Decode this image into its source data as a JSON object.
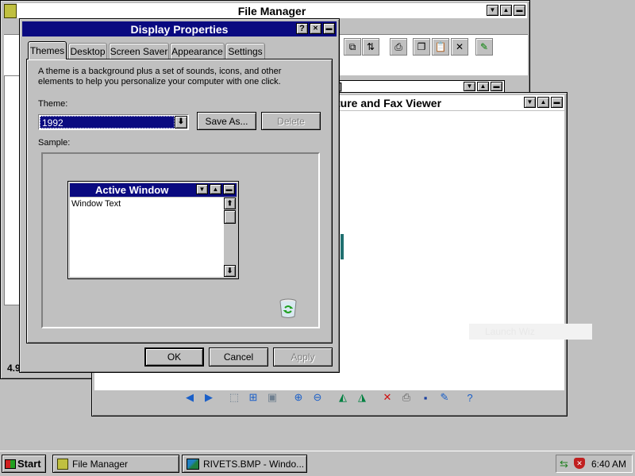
{
  "file_manager": {
    "title": "File Manager",
    "status_value": "4.9",
    "inner_title_partial": "]"
  },
  "picture_viewer": {
    "title_partial": "ture and Fax Viewer",
    "image_label": "Launch Wiz"
  },
  "display_properties": {
    "title": "Display Properties",
    "tabs": [
      {
        "label": "Themes",
        "selected": true
      },
      {
        "label": "Desktop",
        "selected": false
      },
      {
        "label": "Screen Saver",
        "selected": false
      },
      {
        "label": "Appearance",
        "selected": false
      },
      {
        "label": "Settings",
        "selected": false
      }
    ],
    "description": "A theme is a background plus a set of sounds, icons, and other elements to help you personalize your computer with one click.",
    "theme_label": "Theme:",
    "theme_value": "1992",
    "save_as_label": "Save As...",
    "delete_label": "Delete",
    "sample_label": "Sample:",
    "sample_window": {
      "title": "Active Window",
      "text": "Window Text"
    },
    "ok_label": "OK",
    "cancel_label": "Cancel",
    "apply_label": "Apply"
  },
  "taskbar": {
    "start_label": "Start",
    "tasks": [
      {
        "label": "File Manager"
      },
      {
        "label": "RIVETS.BMP - Windo..."
      }
    ],
    "time": "6:40 AM"
  },
  "colors": {
    "desktop": "#c0c0c0",
    "active_title": "#0a0a80",
    "selection": "#0a0a80",
    "window_bg": "#ffffff"
  }
}
